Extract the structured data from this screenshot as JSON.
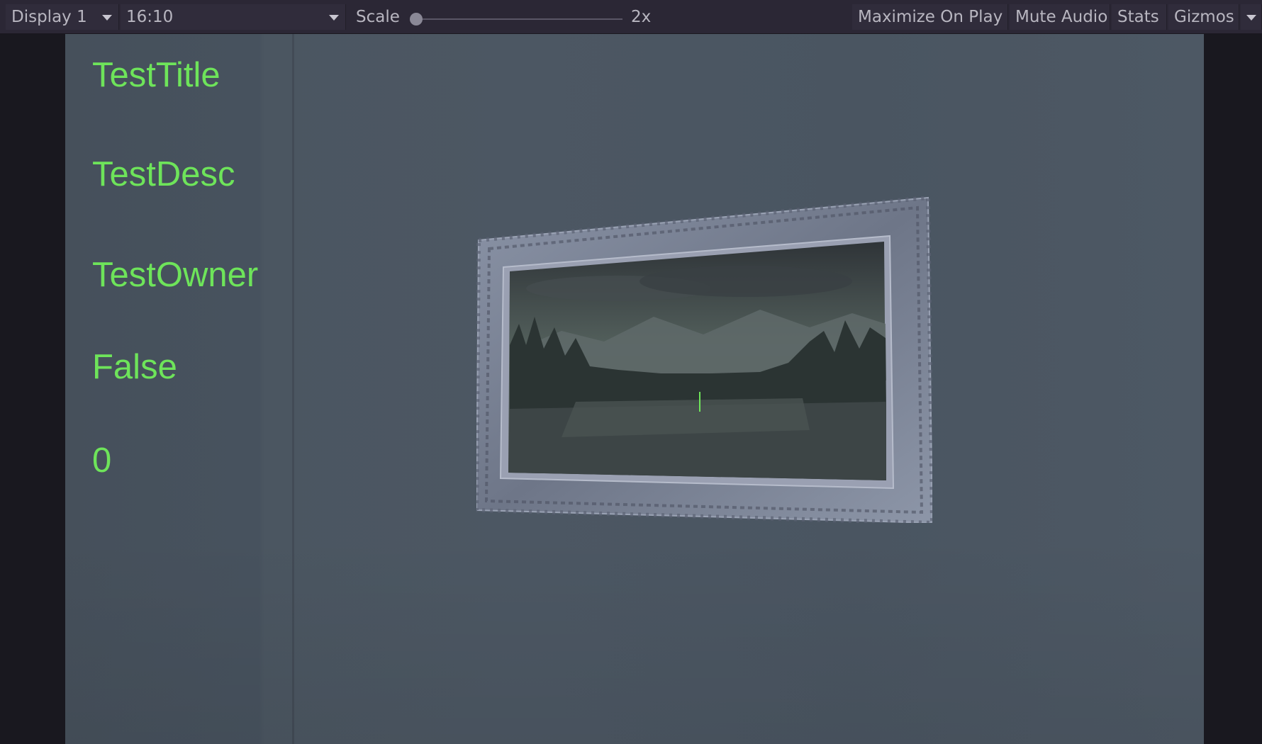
{
  "toolbar": {
    "display": "Display 1",
    "aspect": "16:10",
    "scale_label": "Scale",
    "scale_value": "2x",
    "scale_slider_position": 0.0,
    "maximize_on_play": "Maximize On Play",
    "mute_audio": "Mute Audio",
    "stats": "Stats",
    "gizmos": "Gizmos"
  },
  "game_view": {
    "labels": [
      "TestTitle",
      "TestDesc",
      "TestOwner",
      "False",
      "0"
    ],
    "label_color": "#6ee45a"
  }
}
